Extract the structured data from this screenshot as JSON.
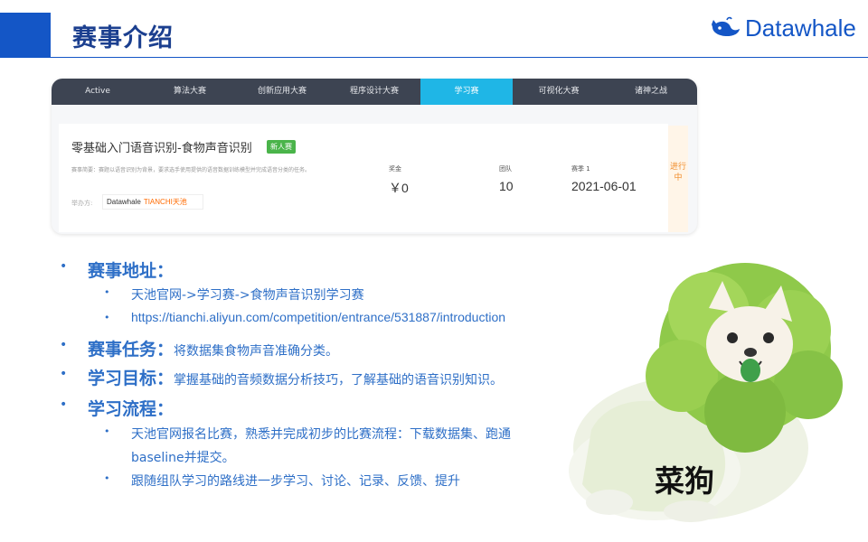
{
  "header": {
    "title": "赛事介绍",
    "brand": "Datawhale",
    "accent_color": "#1456c6"
  },
  "screenshot": {
    "tabs": [
      {
        "label": "Active",
        "active": false
      },
      {
        "label": "算法大赛",
        "active": false
      },
      {
        "label": "创新应用大赛",
        "active": false
      },
      {
        "label": "程序设计大赛",
        "active": false
      },
      {
        "label": "学习赛",
        "active": true
      },
      {
        "label": "可视化大赛",
        "active": false
      },
      {
        "label": "诸神之战",
        "active": false
      }
    ],
    "competition": {
      "title": "零基础入门语音识别-食物声音识别",
      "badge": "新人赛",
      "description": "赛事简要：赛题以语音识别为背景，要求选手使用提供的语音数据训练模型并完成语音分类的任务。",
      "hosts_label": "举办方:",
      "host_logo_1": "Datawhale",
      "host_logo_2": "TIANCHI天池",
      "stats": [
        {
          "label": "奖金",
          "value": "￥0"
        },
        {
          "label": "团队",
          "value": "10"
        },
        {
          "label": "赛季 1",
          "value": "2021-06-01"
        }
      ],
      "status": "进行中"
    }
  },
  "content": {
    "address": {
      "heading": "赛事地址：",
      "items": [
        "天池官网->学习赛->食物声音识别学习赛",
        "https://tianchi.aliyun.com/competition/entrance/531887/introduction"
      ]
    },
    "task": {
      "heading": "赛事任务：",
      "text": "将数据集食物声音准确分类。"
    },
    "goal": {
      "heading": "学习目标：",
      "text": "掌握基础的音频数据分析技巧，了解基础的语音识别知识。"
    },
    "process": {
      "heading": "学习流程：",
      "items": [
        "天池官网报名比赛，熟悉并完成初步的比赛流程：下载数据集、跑通",
        "baseline并提交。",
        "跟随组队学习的路线进一步学习、讨论、记录、反馈、提升"
      ]
    }
  },
  "mascot": {
    "label": "菜狗"
  }
}
